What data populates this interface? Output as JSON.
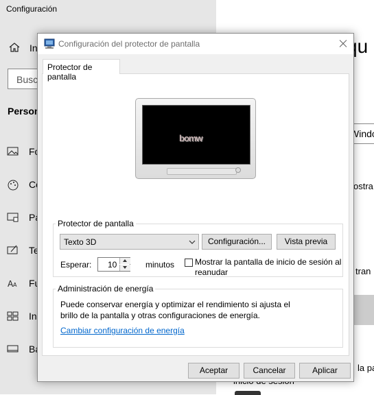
{
  "background": {
    "title": "Configuración",
    "home_label": "In",
    "search_placeholder": "Busca",
    "section": "Person",
    "items": [
      {
        "label": "Fo",
        "icon": "image-icon"
      },
      {
        "label": "Co",
        "icon": "palette-icon"
      },
      {
        "label": "Pa",
        "icon": "lock-screen-icon"
      },
      {
        "label": "Te",
        "icon": "theme-icon"
      },
      {
        "label": "Fu",
        "icon": "font-icon"
      },
      {
        "label": "Ini",
        "icon": "start-icon"
      },
      {
        "label": "Ba",
        "icon": "taskbar-icon"
      }
    ],
    "right_texts": {
      "big": "qu",
      "box": "Windo",
      "line1": "ostra",
      "line2": "tran",
      "line3": "la pa",
      "line4": "inicio de sesión"
    }
  },
  "dialog": {
    "title": "Configuración del protector de pantalla",
    "tab": "Protector de pantalla",
    "preview_text": "bomw",
    "screensaver_group": {
      "label": "Protector de pantalla",
      "selected": "Texto 3D",
      "settings_button": "Configuración...",
      "preview_button": "Vista previa",
      "wait_label": "Esperar:",
      "wait_value": "10",
      "minutes_label": "minutos",
      "logon_checkbox_checked": false,
      "logon_checkbox_label": "Mostrar la pantalla de inicio de sesión al reanudar"
    },
    "power_group": {
      "label": "Administración de energía",
      "description": "Puede conservar energía y optimizar el rendimiento si ajusta el brillo de la pantalla y otras configuraciones de energía.",
      "link": "Cambiar configuración de energía"
    },
    "buttons": {
      "ok": "Aceptar",
      "cancel": "Cancelar",
      "apply": "Aplicar"
    }
  },
  "colors": {
    "link": "#0066cc",
    "dialog_bg": "#f0f0f0",
    "sidebar_bg": "#e6e6e6"
  }
}
